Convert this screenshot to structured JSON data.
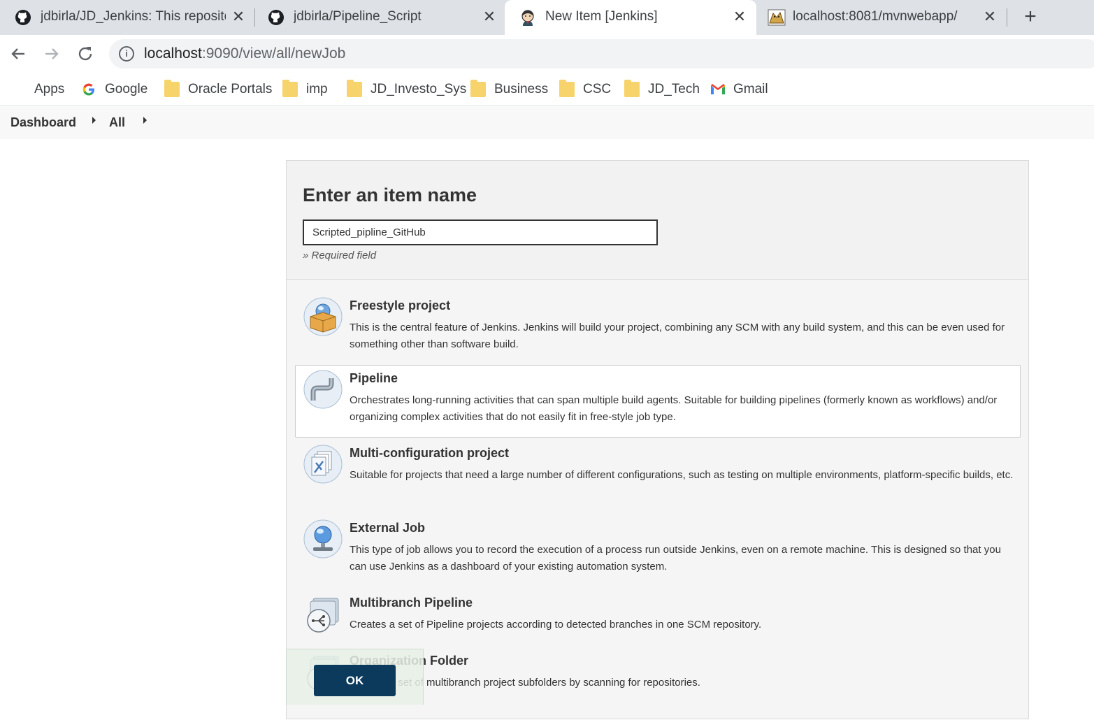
{
  "browser": {
    "tabs": [
      {
        "title": "jdbirla/JD_Jenkins: This repository",
        "icon": "github-icon",
        "active": false
      },
      {
        "title": "jdbirla/Pipeline_Script",
        "icon": "github-icon",
        "active": false
      },
      {
        "title": "New Item [Jenkins]",
        "icon": "jenkins-icon",
        "active": true
      },
      {
        "title": "localhost:8081/mvnwebapp/",
        "icon": "tomcat-icon",
        "active": false
      }
    ],
    "address": {
      "host": "localhost",
      "path": ":9090/view/all/newJob"
    },
    "bookmarks": [
      {
        "label": "Apps",
        "icon": "apps-grid-icon"
      },
      {
        "label": "Google",
        "icon": "google-icon"
      },
      {
        "label": "Oracle Portals",
        "icon": "folder-icon"
      },
      {
        "label": "imp",
        "icon": "folder-icon"
      },
      {
        "label": "JD_Investo_Sys",
        "icon": "folder-icon"
      },
      {
        "label": "Business",
        "icon": "folder-icon"
      },
      {
        "label": "CSC",
        "icon": "folder-icon"
      },
      {
        "label": "JD_Tech",
        "icon": "folder-icon"
      },
      {
        "label": "Gmail",
        "icon": "gmail-icon"
      }
    ]
  },
  "breadcrumb": {
    "items": [
      "Dashboard",
      "All"
    ]
  },
  "form": {
    "heading": "Enter an item name",
    "item_name": "Scripted_pipline_GitHub",
    "required_note": "» Required field",
    "ok_label": "OK"
  },
  "item_types": [
    {
      "label": "Freestyle project",
      "desc": "This is the central feature of Jenkins. Jenkins will build your project, combining any SCM with any build system, and this can be even used for something other than software build.",
      "icon": "freestyle-project-icon",
      "selected": false
    },
    {
      "label": "Pipeline",
      "desc": "Orchestrates long-running activities that can span multiple build agents. Suitable for building pipelines (formerly known as workflows) and/or organizing complex activities that do not easily fit in free-style job type.",
      "icon": "pipeline-icon",
      "selected": true
    },
    {
      "label": "Multi-configuration project",
      "desc": "Suitable for projects that need a large number of different configurations, such as testing on multiple environments, platform-specific builds, etc.",
      "icon": "multi-configuration-icon",
      "selected": false
    },
    {
      "label": "External Job",
      "desc": "This type of job allows you to record the execution of a process run outside Jenkins, even on a remote machine. This is designed so that you can use Jenkins as a dashboard of your existing automation system.",
      "icon": "external-job-icon",
      "selected": false
    },
    {
      "label": "Multibranch Pipeline",
      "desc": "Creates a set of Pipeline projects according to detected branches in one SCM repository.",
      "icon": "multibranch-pipeline-icon",
      "selected": false
    },
    {
      "label": "Organization Folder",
      "desc": "Creates a set of multibranch project subfolders by scanning for repositories.",
      "icon": "organization-folder-icon",
      "selected": false
    }
  ],
  "colors": {
    "ok_button": "#0b3a5c",
    "tab_strip": "#dee1e6",
    "panel": "#f5f5f5"
  }
}
